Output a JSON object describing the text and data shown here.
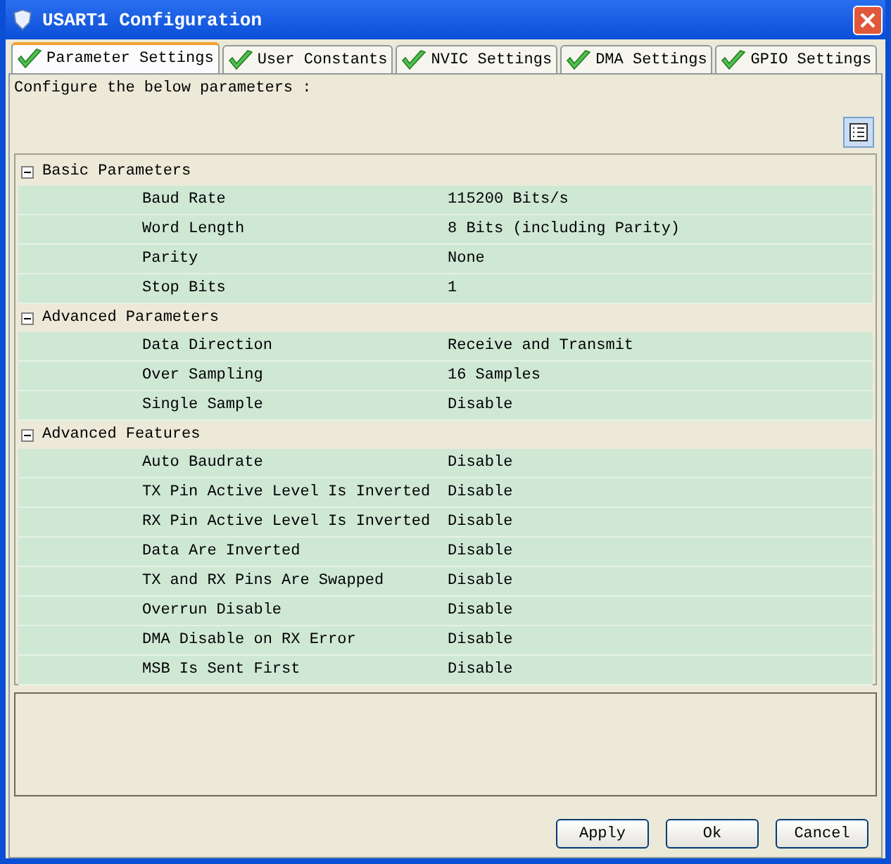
{
  "window": {
    "title": "USART1 Configuration"
  },
  "tabs": [
    {
      "label": "Parameter Settings",
      "selected": true
    },
    {
      "label": "User Constants",
      "selected": false
    },
    {
      "label": "NVIC Settings",
      "selected": false
    },
    {
      "label": "DMA Settings",
      "selected": false
    },
    {
      "label": "GPIO Settings",
      "selected": false
    }
  ],
  "instruction": "Configure the below parameters :",
  "groups": [
    {
      "title": "Basic Parameters",
      "expanded": true,
      "rows": [
        {
          "name": "Baud Rate",
          "value": "115200 Bits/s"
        },
        {
          "name": "Word Length",
          "value": "8 Bits (including Parity)"
        },
        {
          "name": "Parity",
          "value": "None"
        },
        {
          "name": "Stop Bits",
          "value": "1"
        }
      ]
    },
    {
      "title": "Advanced Parameters",
      "expanded": true,
      "rows": [
        {
          "name": "Data Direction",
          "value": "Receive and Transmit"
        },
        {
          "name": "Over Sampling",
          "value": "16 Samples"
        },
        {
          "name": "Single Sample",
          "value": "Disable"
        }
      ]
    },
    {
      "title": "Advanced Features",
      "expanded": true,
      "rows": [
        {
          "name": "Auto Baudrate",
          "value": "Disable"
        },
        {
          "name": "TX Pin Active Level Is Inverted",
          "value": "Disable"
        },
        {
          "name": "RX Pin Active Level Is Inverted",
          "value": "Disable"
        },
        {
          "name": "Data Are Inverted",
          "value": "Disable"
        },
        {
          "name": "TX and RX Pins Are Swapped",
          "value": "Disable"
        },
        {
          "name": "Overrun Disable",
          "value": "Disable"
        },
        {
          "name": "DMA Disable on RX Error",
          "value": "Disable"
        },
        {
          "name": "MSB Is Sent First",
          "value": "Disable"
        }
      ]
    }
  ],
  "buttons": [
    "Apply",
    "Ok",
    "Cancel"
  ]
}
